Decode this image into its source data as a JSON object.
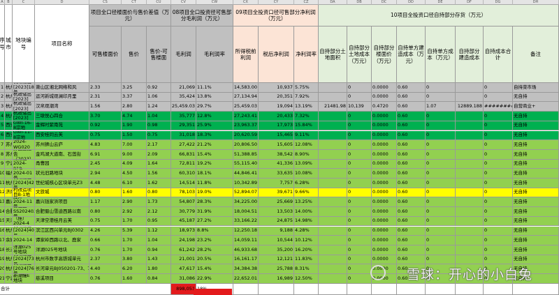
{
  "col_letters": [
    "A",
    "B",
    "C",
    "D",
    "CS",
    "CT",
    "CU",
    "CV",
    "CW",
    "CX",
    "CY",
    "CZ",
    "DA",
    "DB",
    "DC",
    "DD",
    "DE",
    "DF",
    "DG",
    "DH"
  ],
  "headers": {
    "seq": "序号",
    "city": "城市",
    "parcel": "地块编号",
    "project": "项目名称",
    "g_price": "项目全口径楼面价与售价差值（万元）",
    "g_margin": "08项目全口投资径可售部分毛利润（万元）",
    "g_net": "09项目全投资口径可售部分净利润（万元）",
    "g_stock": "10项目全投资口径自持部分存货（万元）",
    "land_price": "可售楼面价",
    "sale_price": "售价",
    "diff": "售价-可售楼面",
    "gross": "毛利润",
    "gross_rate": "毛利润率",
    "pretax": "所得税前利润",
    "net": "税后净利润",
    "net_rate": "净利润率",
    "hold_area": "自持部分土地面积",
    "hold_land_cost": "自持部分土地成本（万元）",
    "hold_land_unit": "自持部分楼面价（万元）",
    "unit_build": "自持单方建造成本（万元）",
    "unit_cost": "自持单方成本（万元）",
    "build_cost": "自持部分建造成本",
    "cost_total": "自持成本合计",
    "note": "备注"
  },
  "rows": [
    {
      "n": "1",
      "city": "杭州",
      "parcel": "杭政储出[2023]18号",
      "name": "萧山区湘北网络和风",
      "lp": "2.33",
      "sp": "3.25",
      "df": "0.92",
      "gross": "21,069",
      "gr": "11.1%",
      "pre": "14,583.00",
      "net": "10,937",
      "nr": "5.75%",
      "a": "",
      "lc": "0",
      "lu": "0.0000",
      "ub": "0.60",
      "uc": "0",
      "bc": "",
      "ct": "0",
      "note": "自持菜市场",
      "color": "#c0c0c0"
    },
    {
      "n": "2",
      "city": "杭州",
      "parcel": "杭政储出[2023]",
      "name": "运河新城观澜印月里",
      "lp": "2.31",
      "sp": "3.37",
      "df": "1.06",
      "gross": "35,424",
      "gr": "13.8%",
      "pre": "27,134.94",
      "net": "20,351",
      "nr": "7.92%",
      "a": "",
      "lc": "0",
      "lu": "0.0000",
      "ub": "0.60",
      "uc": "0",
      "bc": "",
      "ct": "0",
      "note": "无自持",
      "color": "#c0c0c0"
    },
    {
      "n": "3",
      "city": "杭州",
      "parcel": "杭政储出[2023]",
      "name": "汉帛观潮湾",
      "lp": "1.56",
      "sp": "2.80",
      "df": "1.24",
      "gross": "25,459.03",
      "gr": "29.7%",
      "pre": "25,459.03",
      "net": "19,094",
      "nr": "13.19%",
      "a": "21481.98",
      "lc": "10,139",
      "lu": "0.4720",
      "ub": "0.60",
      "uc": "1.07",
      "bc": "12889.188",
      "ct": "########",
      "note": "自营商业+",
      "color": "#c0c0c0"
    },
    {
      "n": "4",
      "city": "杭州",
      "parcel": "杭政储出[2023]",
      "name": "三墩悦心四合",
      "lp": "3.70",
      "sp": "4.74",
      "df": "1.04",
      "gross": "35,777",
      "gr": "12.8%",
      "pre": "27,243.41",
      "net": "20,433",
      "nr": "7.32%",
      "a": "",
      "lc": "0",
      "lu": "0.0000",
      "ub": "0.60",
      "uc": "0",
      "bc": "",
      "ct": "0",
      "note": "无自持",
      "color": "#00b050"
    },
    {
      "n": "5",
      "city": "西安",
      "parcel": "GWI-16-8宗地",
      "name": "金辉时紫南苑",
      "lp": "0.92",
      "sp": "1.90",
      "df": "0.98",
      "gross": "29,351",
      "gr": "25.9%",
      "pre": "23,963.37",
      "net": "17,973",
      "nr": "15.84%",
      "a": "",
      "lc": "0",
      "lu": "0.0000",
      "ub": "0.60",
      "uc": "0",
      "bc": "",
      "ct": "0",
      "note": "无自持",
      "color": "#00b050"
    },
    {
      "n": "6",
      "city": "西安",
      "parcel": "GWI-11-8宗地",
      "name": "西安桂同云芙",
      "lp": "0.75",
      "sp": "1.50",
      "df": "0.75",
      "gross": "31,018",
      "gr": "18.3%",
      "pre": "20,620.59",
      "net": "15,465",
      "nr": "9.11%",
      "a": "",
      "lc": "0",
      "lu": "0.0000",
      "ub": "0.60",
      "uc": "0",
      "bc": "",
      "ct": "0",
      "note": "无自持",
      "color": "#00b050"
    },
    {
      "n": "7",
      "city": "苏州",
      "parcel": "苏地2024-WG020号",
      "name": "苏州狮山云庐",
      "lp": "4.83",
      "sp": "7.00",
      "df": "2.17",
      "gross": "27,422",
      "gr": "21.2%",
      "pre": "20,806.50",
      "net": "15,605",
      "nr": "12.08%",
      "a": "",
      "lc": "0",
      "lu": "0.0000",
      "ub": "0.60",
      "uc": "0",
      "bc": "",
      "ct": "0",
      "note": "无自持",
      "color": "#92d050"
    },
    {
      "n": "8",
      "city": "苏州",
      "parcel": "苏园土挂告（2023）",
      "name": "金鸡湖大道南、石莲街",
      "lp": "6.91",
      "sp": "9.00",
      "df": "2.09",
      "gross": "66,831",
      "gr": "15.4%",
      "pre": "51,388.85",
      "net": "38,542",
      "nr": "8.90%",
      "a": "",
      "lc": "0",
      "lu": "0.0000",
      "ub": "0.60",
      "uc": "0",
      "bc": "",
      "ct": "0",
      "note": "无自持",
      "color": "#92d050"
    },
    {
      "n": "9",
      "city": "宁波",
      "parcel": "甬储出2024-018",
      "name": "甬曹园",
      "lp": "2.45",
      "sp": "4.09",
      "df": "1.64",
      "gross": "72,811",
      "gr": "19.2%",
      "pre": "55,115.40",
      "net": "41,336",
      "nr": "13.09%",
      "a": "",
      "lc": "0",
      "lu": "0.0000",
      "ub": "0.60",
      "uc": "0",
      "bc": "",
      "ct": "0",
      "note": "无自持",
      "color": "#92d050"
    },
    {
      "n": "10",
      "city": "福州",
      "parcel": "宗地2024-01号",
      "name": "状元旧路地块",
      "lp": "2.94",
      "sp": "4.50",
      "df": "1.56",
      "gross": "60,310",
      "gr": "18.1%",
      "pre": "44,846.41",
      "net": "33,635",
      "nr": "10.08%",
      "a": "",
      "lc": "0",
      "lu": "0.0000",
      "ub": "0.60",
      "uc": "0",
      "bc": "",
      "ct": "0",
      "note": "无自持",
      "color": "#92d050"
    },
    {
      "n": "11",
      "city": "杭州",
      "parcel": "杭政储出[2024]42号",
      "name": "世纪城核心区块单元Z3",
      "lp": "4.48",
      "sp": "6.10",
      "df": "1.62",
      "gross": "14,514",
      "gr": "11.8%",
      "pre": "10,342.89",
      "net": "7,757",
      "nr": "6.28%",
      "a": "",
      "lc": "0",
      "lu": "0.0000",
      "ub": "0.60",
      "uc": "0",
      "bc": "",
      "ct": "0",
      "note": "无自持",
      "color": "#92d050"
    },
    {
      "n": "12",
      "city": "济南",
      "parcel": "香田城中村改造项目B-1地块",
      "name": "文旅城",
      "lp": "0.80",
      "sp": "1.60",
      "df": "0.80",
      "gross": "78,103",
      "gr": "19.0%",
      "pre": "52,894.07",
      "net": "39,671",
      "nr": "9.66%",
      "a": "",
      "lc": "0",
      "lu": "0.0000",
      "ub": "0.60",
      "uc": "0",
      "bc": "",
      "ct": "0",
      "note": "无自持",
      "color": "#ffff00"
    },
    {
      "n": "13",
      "city": "嘉兴",
      "parcel": "经开2024-11号",
      "name": "嘉兴钱家浜项目",
      "lp": "1.17",
      "sp": "2.90",
      "df": "1.73",
      "gross": "54,807",
      "gr": "28.3%",
      "pre": "34,225.00",
      "net": "25,669",
      "nr": "13.25%",
      "a": "",
      "lc": "0",
      "lu": "0.0000",
      "ub": "0.60",
      "uc": "0",
      "bc": "",
      "ct": "0",
      "note": "无自持",
      "color": "#92d050"
    },
    {
      "n": "14",
      "city": "合肥",
      "parcel": "蜀山区SS202402号",
      "name": "合肥蜀山雪迪西路以南",
      "lp": "0.80",
      "sp": "2.92",
      "df": "2.12",
      "gross": "30,779",
      "gr": "31.9%",
      "pre": "18,004.51",
      "net": "13,503",
      "nr": "14.00%",
      "a": "",
      "lc": "0",
      "lu": "0.0000",
      "ub": "0.60",
      "uc": "0",
      "bc": "",
      "ct": "0",
      "note": "无自持",
      "color": "#92d050"
    },
    {
      "n": "15",
      "city": "天津",
      "parcel": "津滨南（挂）2024-4号地块",
      "name": "天津空港桂月云芙",
      "lp": "0.75",
      "sp": "1.70",
      "df": "0.95",
      "gross": "45,187",
      "gr": "27.2%",
      "pre": "33,166.22",
      "net": "24,875",
      "nr": "14.98%",
      "a": "",
      "lc": "0",
      "lu": "0.0000",
      "ub": "0.60",
      "uc": "0",
      "bc": "",
      "ct": "0",
      "note": "无自持",
      "color": "#92d050"
    },
    {
      "n": "16",
      "city": "杭州",
      "parcel": "杭政储出[2024]40号",
      "name": "滨江区西兴单元BJ0302",
      "lp": "4.26",
      "sp": "5.39",
      "df": "1.12",
      "gross": "18,973",
      "gr": "8.8%",
      "pre": "12,250.18",
      "net": "9,188",
      "nr": "4.28%",
      "a": "",
      "lc": "0",
      "lu": "0.0000",
      "ub": "0.60",
      "uc": "0",
      "bc": "",
      "ct": "0",
      "note": "无自持",
      "color": "#92d050"
    },
    {
      "n": "17",
      "city": "余姚",
      "parcel": "2024-14",
      "name": "谭家岭西路以北、鹿家",
      "lp": "0.66",
      "sp": "1.70",
      "df": "1.04",
      "gross": "24,198",
      "gr": "23.2%",
      "pre": "14,059.11",
      "net": "10,544",
      "nr": "10.12%",
      "a": "",
      "lc": "0",
      "lu": "0.0000",
      "ub": "0.60",
      "uc": "0",
      "bc": "",
      "ct": "0",
      "note": "无自持",
      "color": "#92d050"
    },
    {
      "n": "18",
      "city": "长沙",
      "parcel": "洋湖025号地块",
      "name": "洋湖025号地块",
      "lp": "0.76",
      "sp": "1.70",
      "df": "0.94",
      "gross": "61,242",
      "gr": "28.2%",
      "pre": "46,933.68",
      "net": "35,200",
      "nr": "16.20%",
      "a": "",
      "lc": "0",
      "lu": "0.0000",
      "ub": "0.60",
      "uc": "0",
      "bc": "",
      "ct": "0",
      "note": "无自持",
      "color": "#92d050"
    },
    {
      "n": "19",
      "city": "杭州",
      "parcel": "杭政储出[2024]73号",
      "name": "杭州市数字高铁城单元",
      "lp": "2.37",
      "sp": "3.80",
      "df": "1.43",
      "gross": "21,001",
      "gr": "20.5%",
      "pre": "16,161.17",
      "net": "12,121",
      "nr": "11.83%",
      "a": "",
      "lc": "0",
      "lu": "0.0000",
      "ub": "0.60",
      "uc": "0",
      "bc": "",
      "ct": "0",
      "note": "无自持",
      "color": "#92d050"
    },
    {
      "n": "20",
      "city": "杭州",
      "parcel": "杭政储出[2024]76号",
      "name": "长河单元BJ050201-73、74地块",
      "lp": "4.40",
      "sp": "6.20",
      "df": "1.80",
      "gross": "47,617",
      "gr": "15.4%",
      "pre": "34,384.38",
      "net": "25,788",
      "nr": "8.31%",
      "a": "",
      "lc": "0",
      "lu": "0.0000",
      "ub": "0.60",
      "uc": "0",
      "bc": "",
      "ct": "0",
      "note": "无自持",
      "color": "#92d050"
    },
    {
      "n": "21",
      "city": "宁波",
      "parcel": "新潮鳗E地块",
      "name": "慈溪项目",
      "lp": "0.76",
      "sp": "1.60",
      "df": "0.84",
      "gross": "31,086",
      "gr": "22.9%",
      "pre": "22,652.01",
      "net": "16,989",
      "nr": "12.50%",
      "a": "",
      "lc": "0",
      "lu": "0.0000",
      "ub": "0.60",
      "uc": "0",
      "bc": "",
      "ct": "0",
      "note": "无自持",
      "color": "#92d050"
    }
  ],
  "total": {
    "label": "合计",
    "gross": "898,051",
    "gr": "18%"
  },
  "watermark": "雪球：开心的小白兔",
  "colors": {
    "grey": "#c0c0c0",
    "green": "#00b050",
    "lightgreen": "#92d050",
    "yellow": "#ffff00",
    "salmon": "#fce4d6",
    "mint": "#e2efda",
    "red": "#e31a1c"
  }
}
